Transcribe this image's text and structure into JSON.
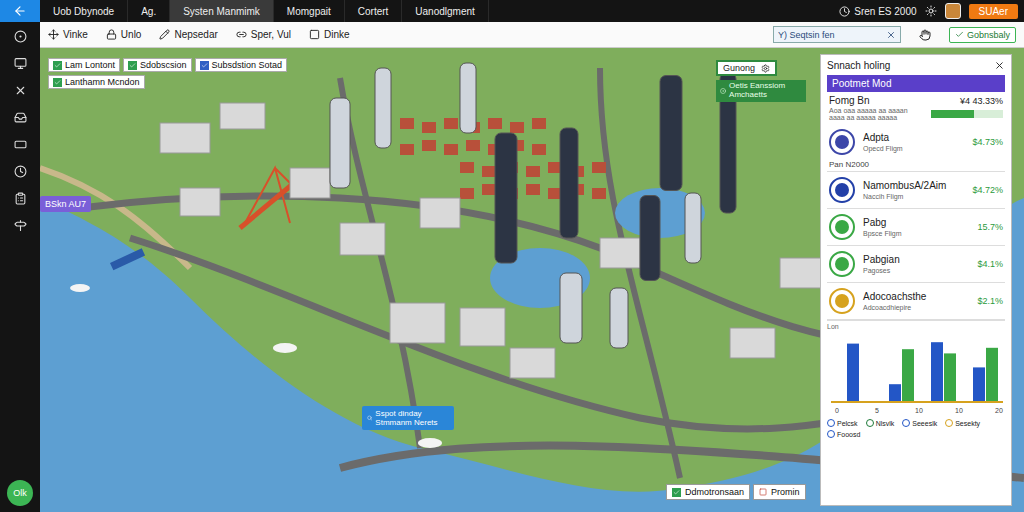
{
  "topbar": {
    "tabs": [
      {
        "label": "Uob Dbynode",
        "selected": false
      },
      {
        "label": "Ag.",
        "selected": false
      },
      {
        "label": "Systen Manmimk",
        "selected": true
      },
      {
        "label": "Momgpait",
        "selected": false
      },
      {
        "label": "Cortert",
        "selected": false
      },
      {
        "label": "Uanodlgment",
        "selected": false
      }
    ],
    "clock": "Sren ES 2000",
    "user_button": "SUAer"
  },
  "sidebar": {
    "badge": "Olk"
  },
  "toolbar": {
    "tools": [
      {
        "label": "Vinke"
      },
      {
        "label": "Unlo"
      },
      {
        "label": "Nepsedar"
      },
      {
        "label": "Sper, Vul"
      },
      {
        "label": "Dinke"
      }
    ],
    "search": {
      "value": "Y) Seqtsin fen"
    },
    "button": "Gobnsbaly"
  },
  "map": {
    "layers": [
      {
        "label": "Lam Lontont",
        "checked": true,
        "color": "#2e9e4f"
      },
      {
        "label": "Sdobscsion",
        "checked": true,
        "color": "#2e9e4f"
      },
      {
        "label": "Subsdstion Sotad",
        "checked": true,
        "color": "#2f5fc4"
      },
      {
        "label": "Lanthamn Mcndon",
        "checked": true,
        "color": "#2e9e4f"
      }
    ],
    "district_tag": "BSkn AU7",
    "zone_label": "Gunong",
    "zone_tooltip": "Oetis Eanssiom Amchaetts",
    "info_tooltip": "Sspot dinday Stmmanm Nerets",
    "bottom_toggle": {
      "label": "Ddmotronsaan",
      "checked": true
    },
    "bottom_button": "Promin"
  },
  "panel": {
    "title": "Snnach holing",
    "header": "Pootmet Mod",
    "summary": {
      "name": "Fomg Bn",
      "value": "¥4 43.33%",
      "detail": "Aoa oaa aaaaa aa aaaan",
      "detail2": "aaaa aa aaaaa aaaaa",
      "level": 0.6
    },
    "featured": {
      "name": "Adpta",
      "sub": "Opecd Fligm",
      "value": "$4.73%",
      "color": "#3c46a8"
    },
    "section": "Pan N2000",
    "items": [
      {
        "name": "NamombusA/2Aim",
        "sub": "Naccih Fligm",
        "value": "$4.72%",
        "color": "#2340a8"
      },
      {
        "name": "Pabg",
        "sub": "Bpsce Fligm",
        "value": "15.7%",
        "color": "#3aa845"
      },
      {
        "name": "Pabgian",
        "sub": "Pagoses",
        "value": "$4.1%",
        "color": "#3aa845"
      },
      {
        "name": "Adocoachsthe",
        "sub": "Adcoacdhiepire",
        "value": "$2.1%",
        "color": "#d6a21e"
      }
    ],
    "chart": {
      "y_label": "Lon",
      "x_ticks": [
        "0",
        "5",
        "10",
        "10",
        "20"
      ],
      "series": [
        {
          "name": "blue",
          "color": "#2356c6",
          "values": [
            82,
            24,
            84,
            48
          ]
        },
        {
          "name": "green",
          "color": "#3aa845",
          "values": [
            0,
            74,
            68,
            76
          ]
        }
      ]
    },
    "legend": [
      {
        "label": "Pelcsk",
        "color": "#2356c6"
      },
      {
        "label": "Nlsvlk",
        "color": "#1f7a3a"
      },
      {
        "label": "Seeeslk",
        "color": "#2356c6"
      },
      {
        "label": "Sesekty",
        "color": "#d6a21e"
      },
      {
        "label": "Fooosd",
        "color": "#2356c6"
      }
    ]
  }
}
